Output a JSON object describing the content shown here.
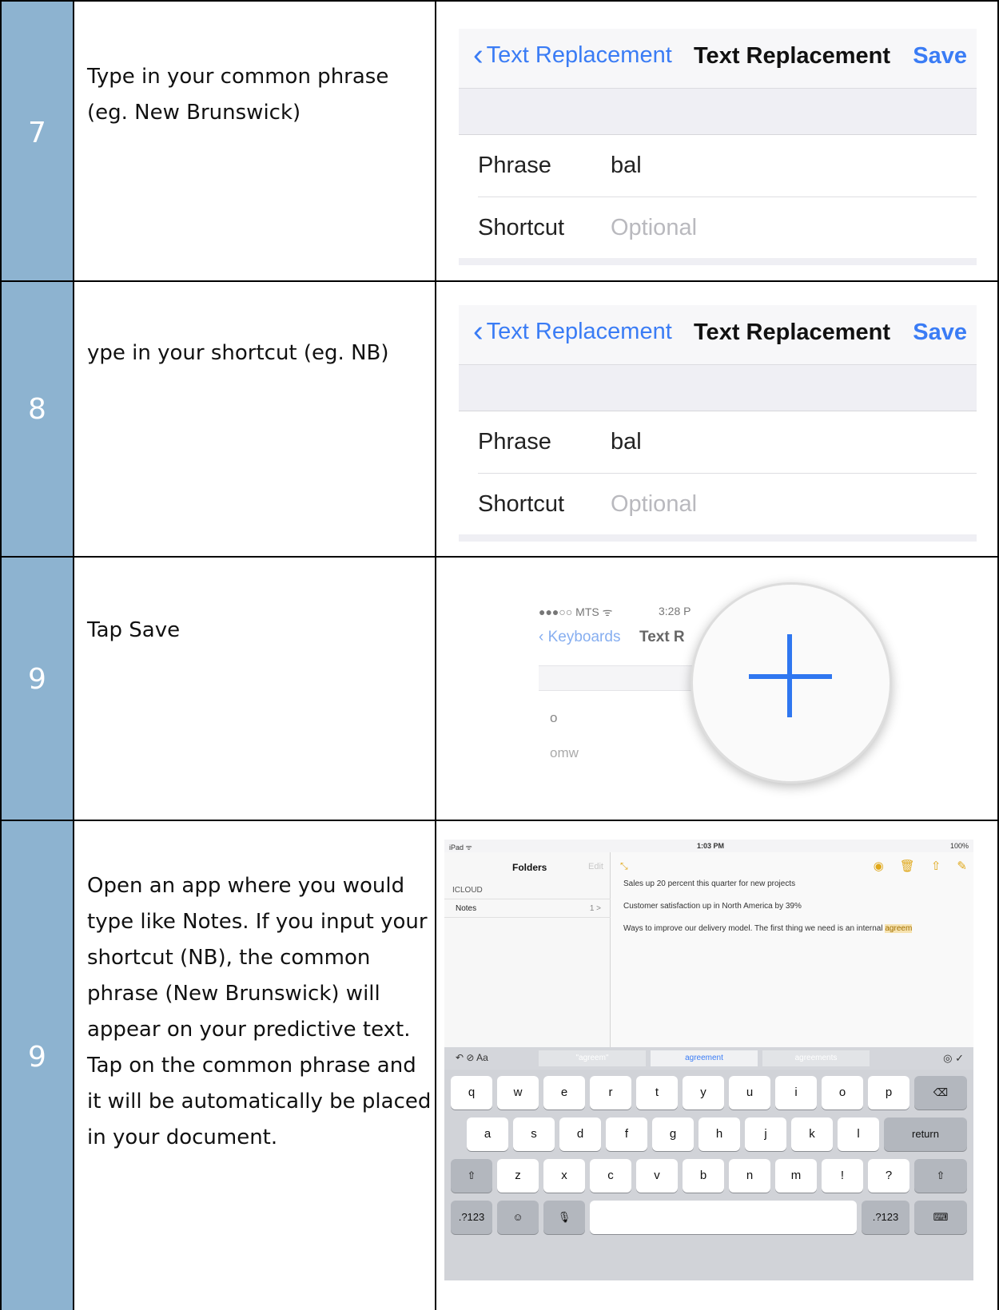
{
  "rows": [
    {
      "number": "7",
      "instruction_lines": [
        "Type in your common phrase",
        "(eg. New Brunswick)"
      ],
      "screen": {
        "back_label": "Text Replacement",
        "title": "Text Replacement",
        "save": "Save",
        "phrase_label": "Phrase",
        "phrase_value": "bal",
        "shortcut_label": "Shortcut",
        "shortcut_placeholder": "Optional"
      }
    },
    {
      "number": "8",
      "instruction_lines": [
        "ype in your shortcut (eg. NB)"
      ],
      "screen": {
        "back_label": "Text Replacement",
        "title": "Text Replacement",
        "save": "Save",
        "phrase_label": "Phrase",
        "phrase_value": "bal",
        "shortcut_label": "Shortcut",
        "shortcut_placeholder": "Optional"
      }
    },
    {
      "number": "9",
      "instruction_lines": [
        "Tap Save"
      ],
      "screen": {
        "status": "●●●○○ MTS ᯤ",
        "time": "3:28 P",
        "back_label": "Keyboards",
        "title_fragment": "Text R",
        "item_1": "o",
        "item_2": "omw"
      }
    },
    {
      "number": "9",
      "instruction_lines": [
        "Open an app where you would",
        "type like Notes. If you input your",
        "shortcut (NB), the common",
        "phrase (New Brunswick) will",
        "appear on your predictive text.",
        "Tap on the common phrase and",
        "it will be automatically be placed",
        "in your document."
      ],
      "screen": {
        "status_left": "iPad ᯤ",
        "status_time": "1:03 PM",
        "status_right": "100%",
        "folders": "Folders",
        "edit": "Edit",
        "icloud": "ICLOUD",
        "notes": "Notes",
        "notes_count": "1 >",
        "note_lines": [
          "Sales up 20 percent this quarter for new projects",
          "Customer satisfaction up in North America by 39%",
          "Ways to improve our delivery model. The first thing we need is an internal "
        ],
        "note_highlight": "agreem",
        "suggestions": [
          "\"agreem\"",
          "agreement",
          "agreements"
        ],
        "keys_row1": [
          "q",
          "w",
          "e",
          "r",
          "t",
          "y",
          "u",
          "i",
          "o",
          "p"
        ],
        "keys_row2": [
          "a",
          "s",
          "d",
          "f",
          "g",
          "h",
          "j",
          "k",
          "l"
        ],
        "keys_row3": [
          "z",
          "x",
          "c",
          "v",
          "b",
          "n",
          "m",
          "!",
          "?"
        ],
        "return_key": "return",
        "numbers_key": ".?123"
      }
    }
  ]
}
